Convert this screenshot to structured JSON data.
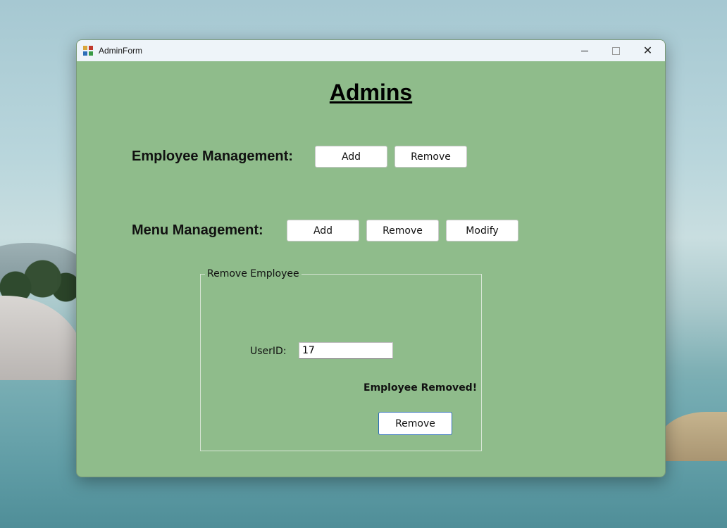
{
  "window": {
    "title": "AdminForm"
  },
  "heading": "Admins",
  "employee_management": {
    "label": "Employee Management:",
    "add_label": "Add",
    "remove_label": "Remove"
  },
  "menu_management": {
    "label": "Menu Management:",
    "add_label": "Add",
    "remove_label": "Remove",
    "modify_label": "Modify"
  },
  "remove_employee_group": {
    "title": "Remove Employee",
    "userid_label": "UserID:",
    "userid_value": "17",
    "status_text": "Employee Removed!",
    "remove_label": "Remove"
  },
  "colors": {
    "form_background": "#8fbc8b",
    "title_bar": "#eef4f9",
    "focused_button_border": "#2b6cb8"
  },
  "icons": {
    "app": "windows-form-icon",
    "minimize": "minimize-icon",
    "maximize": "maximize-icon",
    "close": "close-icon"
  }
}
